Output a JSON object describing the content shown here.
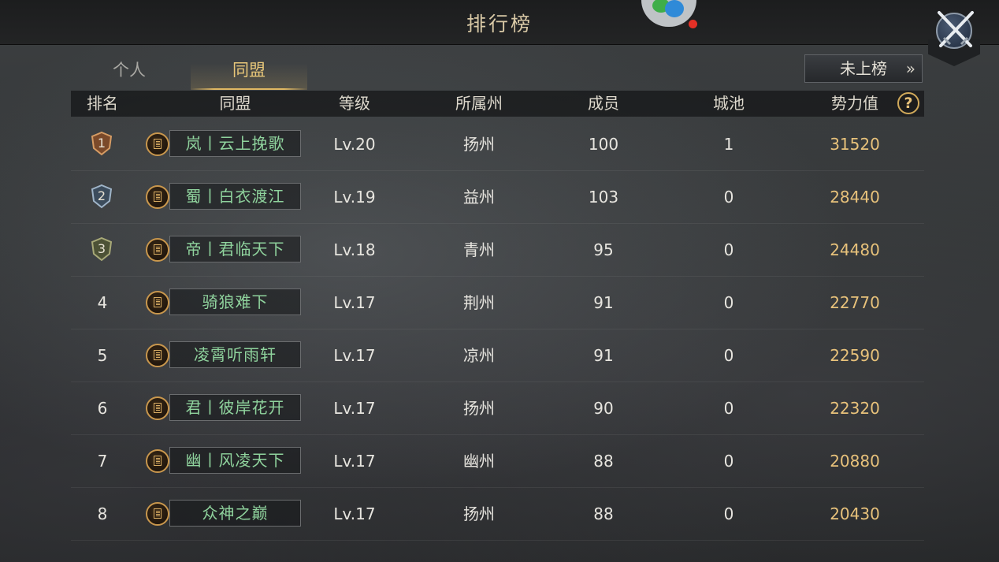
{
  "header": {
    "title": "排行榜"
  },
  "tabs": [
    {
      "label": "个人",
      "active": false
    },
    {
      "label": "同盟",
      "active": true
    }
  ],
  "unranked_button": {
    "label": "未上榜",
    "chevron": "»"
  },
  "columns": [
    "排名",
    "同盟",
    "等级",
    "所属州",
    "成员",
    "城池",
    "势力值"
  ],
  "help_icon": {
    "glyph": "?"
  },
  "colors": {
    "accent_gold": "#e8c27b",
    "alliance_green": "#8fd39d",
    "notification_red": "#e53026"
  },
  "rows": [
    {
      "rank": "1",
      "medal": "gold",
      "alliance": "岚丨云上挽歌",
      "level": "Lv.20",
      "state": "扬州",
      "members": "100",
      "cities": "1",
      "power": "31520"
    },
    {
      "rank": "2",
      "medal": "silver",
      "alliance": "蜀丨白衣渡江",
      "level": "Lv.19",
      "state": "益州",
      "members": "103",
      "cities": "0",
      "power": "28440"
    },
    {
      "rank": "3",
      "medal": "bronze",
      "alliance": "帝丨君临天下",
      "level": "Lv.18",
      "state": "青州",
      "members": "95",
      "cities": "0",
      "power": "24480"
    },
    {
      "rank": "4",
      "medal": "none",
      "alliance": "骑狼难下",
      "level": "Lv.17",
      "state": "荆州",
      "members": "91",
      "cities": "0",
      "power": "22770"
    },
    {
      "rank": "5",
      "medal": "none",
      "alliance": "凌霄听雨轩",
      "level": "Lv.17",
      "state": "凉州",
      "members": "91",
      "cities": "0",
      "power": "22590"
    },
    {
      "rank": "6",
      "medal": "none",
      "alliance": "君丨彼岸花开",
      "level": "Lv.17",
      "state": "扬州",
      "members": "90",
      "cities": "0",
      "power": "22320"
    },
    {
      "rank": "7",
      "medal": "none",
      "alliance": "幽丨风凌天下",
      "level": "Lv.17",
      "state": "幽州",
      "members": "88",
      "cities": "0",
      "power": "20880"
    },
    {
      "rank": "8",
      "medal": "none",
      "alliance": "众神之巅",
      "level": "Lv.17",
      "state": "扬州",
      "members": "88",
      "cities": "0",
      "power": "20430"
    }
  ]
}
